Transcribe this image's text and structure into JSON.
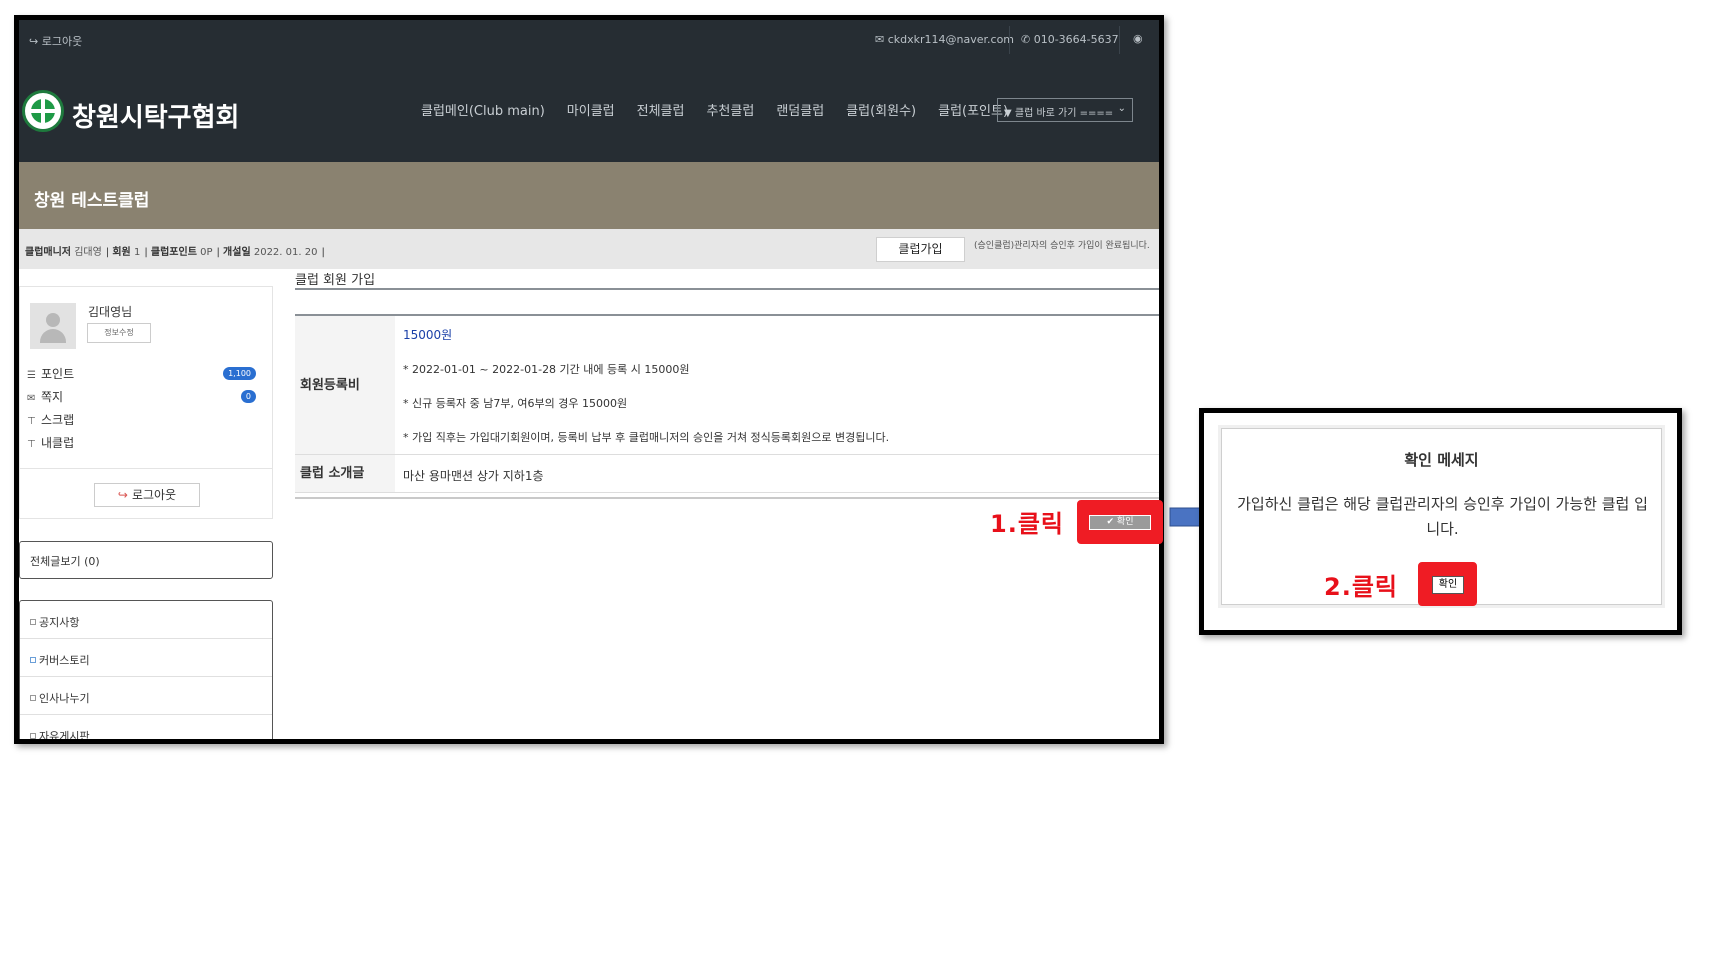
{
  "topbar": {
    "logout": "로그아웃",
    "email": "ckdxkr114@naver.com",
    "phone": "010-3664-5637"
  },
  "header": {
    "site_title": "창원시탁구협회",
    "nav": [
      "클럽메인(Club main)",
      "마이클럽",
      "전체클럽",
      "추천클럽",
      "랜덤클럽",
      "클럽(회원수)",
      "클럽(포인트)"
    ],
    "club_select": "▼ 클럽 바로 가기 ===="
  },
  "club": {
    "name": "창원 테스트클럽",
    "manager_label": "클럽매니저",
    "manager_value": "김대영",
    "members_label": "회원",
    "members_value": "1",
    "points_label": "클럽포인트",
    "points_value": "0P",
    "opened_label": "개설일",
    "opened_value": "2022. 01. 20",
    "join_button": "클럽가입",
    "join_note": "(승인클럽)관리자의 승인후 가입이 완료됩니다."
  },
  "profile": {
    "name": "김대영님",
    "edit_button": "정보수정",
    "stats": [
      {
        "label": "포인트",
        "icon": "database-icon",
        "badge": "1,100"
      },
      {
        "label": "쪽지",
        "icon": "envelope-icon",
        "badge": "0"
      },
      {
        "label": "스크랩",
        "icon": "pin-icon",
        "badge": ""
      },
      {
        "label": "내클럽",
        "icon": "pin-icon",
        "badge": ""
      }
    ],
    "logout_button": "로그아웃"
  },
  "sidebar": {
    "all_posts": "전체글보기 (0)",
    "boards": [
      "공지사항",
      "커버스토리",
      "인사나누기",
      "자유게시판"
    ]
  },
  "main": {
    "title": "클럽 회원 가입",
    "fee_label": "회원등록비",
    "fee_amount": "15000원",
    "fee_lines": [
      "* 2022-01-01 ~ 2022-01-28 기간 내에 등록 시 15000원",
      "* 신규 등록자 중 남7부, 여6부의 경우 15000원",
      "* 가입 직후는 가입대기회원이며, 등록비 납부 후 클럽매니저의 승인을 거쳐 정식등록회원으로 변경됩니다."
    ],
    "intro_label": "클럽 소개글",
    "intro_value": "마산 용마맨션 상가 지하1층",
    "confirm_button": "✔ 확인"
  },
  "annotations": {
    "step1": "1.클릭",
    "step2": "2.클릭"
  },
  "dialog": {
    "title": "확인 메세지",
    "message": "가입하신 클럽은 해당 클럽관리자의 승인후 가입이 가능한 클럽 입니다.",
    "ok_button": "확인"
  },
  "colors": {
    "header_bg": "#262d33",
    "banner_bg": "#8a8270",
    "annotation_red": "#ef1c24",
    "arrow_blue": "#4a73c2",
    "badge_blue": "#2a6fd1"
  }
}
